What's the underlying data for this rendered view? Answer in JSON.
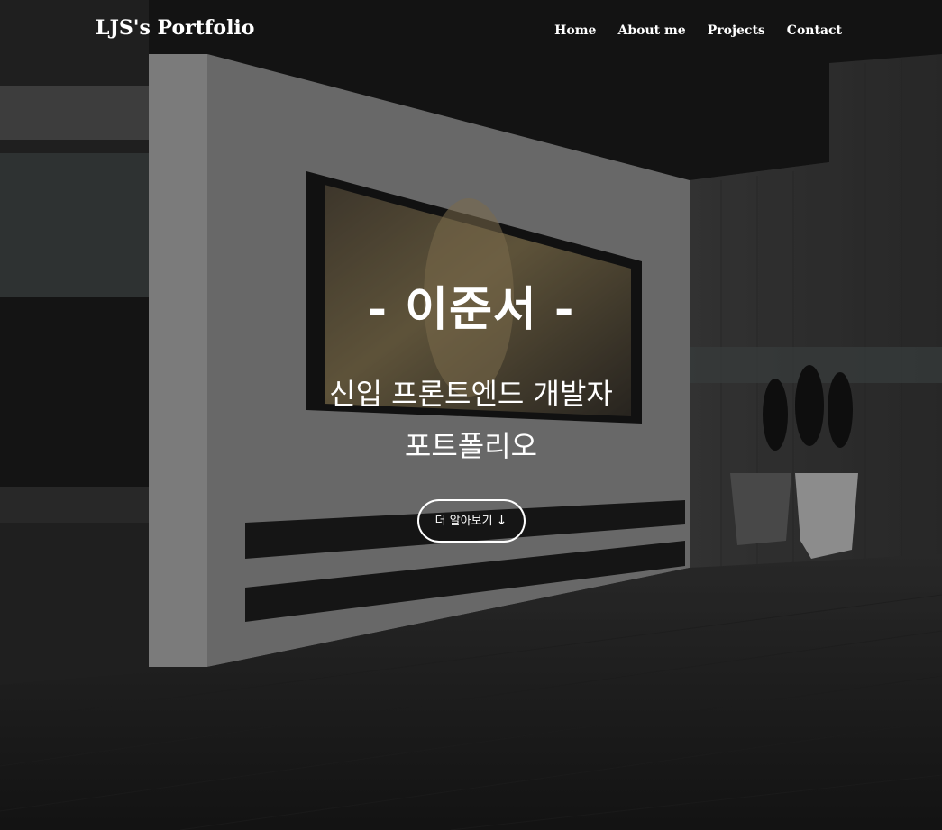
{
  "header": {
    "brand": "LJS's Portfolio",
    "nav": [
      "Home",
      "About me",
      "Projects",
      "Contact"
    ]
  },
  "hero": {
    "title": "- 이준서 -",
    "subtitle_line1": "신입 프론트엔드 개발자",
    "subtitle_line2": "포트폴리오",
    "button_label": "더 알아보기",
    "button_icon": "↓"
  },
  "colors": {
    "text": "#ffffff",
    "overlay": "rgba(0,0,0,0.32)"
  },
  "background": {
    "icon": "modern-interior-photo"
  }
}
